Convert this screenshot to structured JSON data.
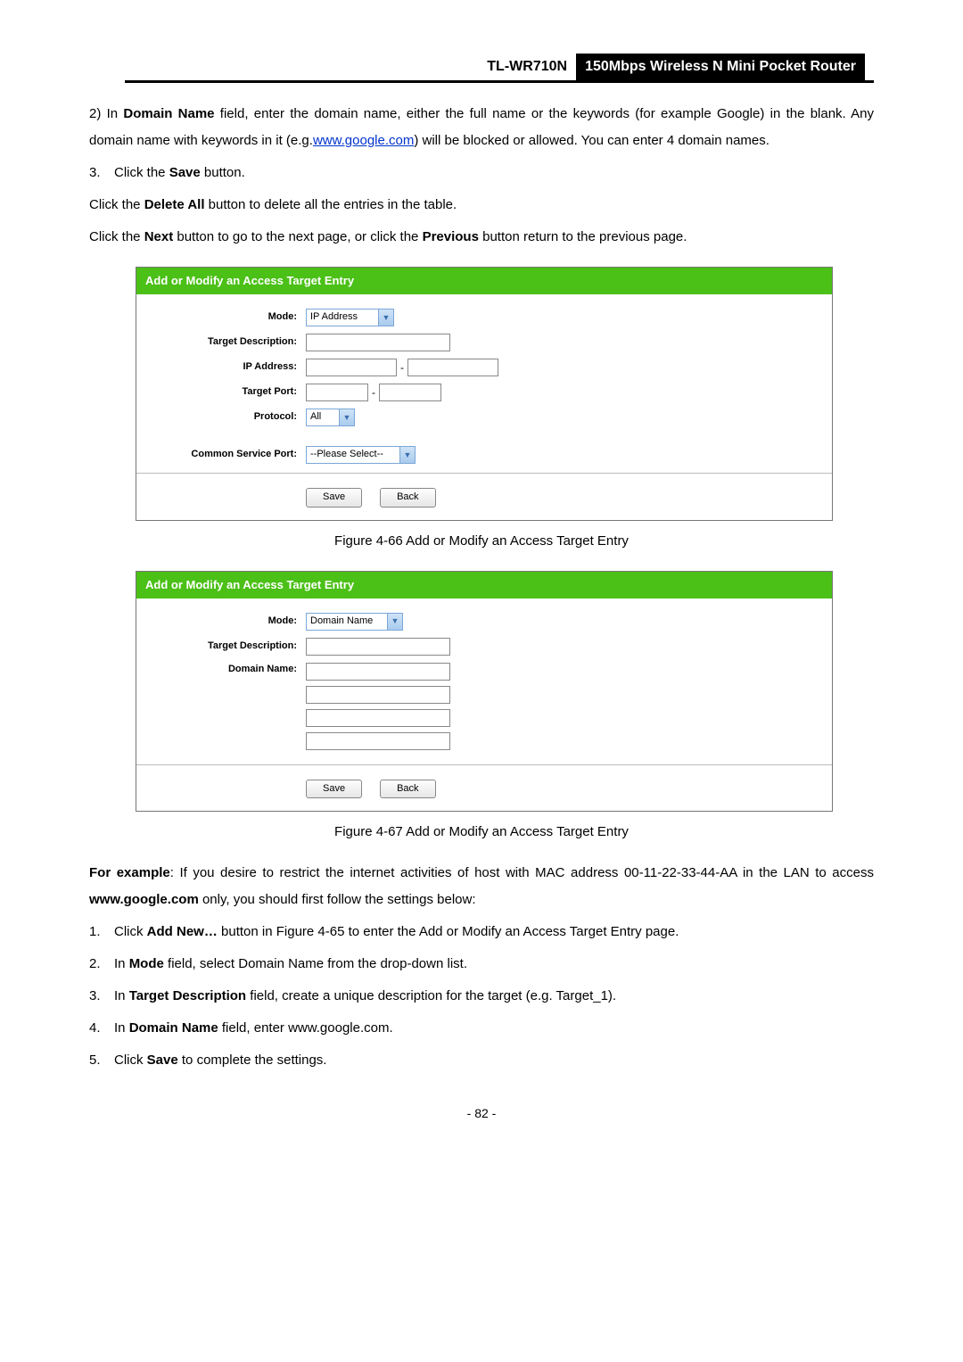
{
  "header": {
    "model": "TL-WR710N",
    "product": "150Mbps Wireless N Mini Pocket Router"
  },
  "body": {
    "p1_pre": "2)   In ",
    "p1_b1": "Domain Name",
    "p1_mid": " field, enter the domain name, either the full name or the keywords (for example Google) in the blank. Any domain name with keywords in it (e.g.",
    "p1_link": "www.google.com",
    "p1_post": ") will be blocked or allowed. You can enter 4 domain names.",
    "p2_num": "3.",
    "p2_pre": "Click the ",
    "p2_b": "Save",
    "p2_post": " button.",
    "p3_pre": "Click the ",
    "p3_b": "Delete All",
    "p3_post": " button to delete all the entries in the table.",
    "p4_pre": "Click the ",
    "p4_b1": "Next",
    "p4_mid": " button to go to the next page, or click the ",
    "p4_b2": "Previous",
    "p4_post": " button return to the previous page."
  },
  "fig1": {
    "title": "Add or Modify an Access Target Entry",
    "mode_label": "Mode:",
    "mode_value": "IP Address",
    "desc_label": "Target Description:",
    "ip_label": "IP Address:",
    "port_label": "Target Port:",
    "proto_label": "Protocol:",
    "proto_value": "All",
    "csp_label": "Common Service Port:",
    "csp_value": "--Please Select--",
    "save": "Save",
    "back": "Back",
    "caption": "Figure 4-66    Add or Modify an Access Target Entry"
  },
  "fig2": {
    "title": "Add or Modify an Access Target Entry",
    "mode_label": "Mode:",
    "mode_value": "Domain Name",
    "desc_label": "Target Description:",
    "domain_label": "Domain Name:",
    "save": "Save",
    "back": "Back",
    "caption": "Figure 4-67    Add or Modify an Access Target Entry"
  },
  "example": {
    "pre": "For example",
    "text1": ": If you desire to restrict the internet activities of host with MAC address 00-11-22-33-44-AA in the LAN to access ",
    "b1": "www.google.com",
    "text2": " only, you should first follow the settings below:",
    "steps": [
      {
        "n": "1.",
        "pre": "Click ",
        "b": "Add New…",
        "post": " button in Figure 4-65 to enter the Add or Modify an Access Target Entry page."
      },
      {
        "n": "2.",
        "pre": "In ",
        "b": "Mode",
        "post": " field, select Domain Name from the drop-down list."
      },
      {
        "n": "3.",
        "pre": "In ",
        "b": "Target Description",
        "post": " field, create a unique description for the target (e.g. Target_1)."
      },
      {
        "n": "4.",
        "pre": "In ",
        "b": "Domain Name",
        "post": " field, enter www.google.com."
      },
      {
        "n": "5.",
        "pre": "Click ",
        "b": "Save",
        "post": " to complete the settings."
      }
    ]
  },
  "page_num": "- 82 -"
}
